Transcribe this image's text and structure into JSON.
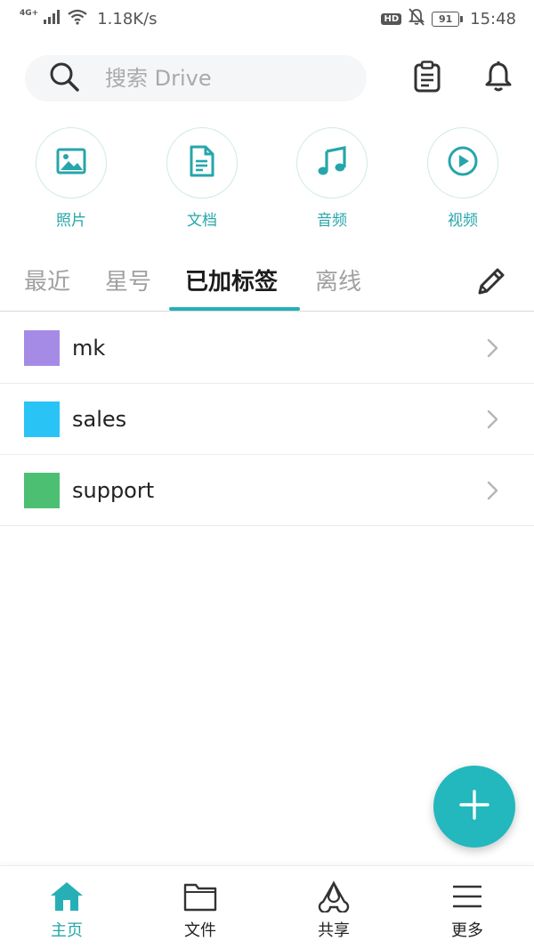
{
  "status_bar": {
    "network_type": "4G+",
    "speed": "1.18K/s",
    "hd": "HD",
    "battery": "91",
    "time": "15:48"
  },
  "search": {
    "placeholder": "搜索 Drive"
  },
  "categories": [
    {
      "label": "照片",
      "icon": "image-icon"
    },
    {
      "label": "文档",
      "icon": "document-icon"
    },
    {
      "label": "音频",
      "icon": "music-note-icon"
    },
    {
      "label": "视频",
      "icon": "play-circle-icon"
    }
  ],
  "tabs": [
    {
      "label": "最近",
      "active": false
    },
    {
      "label": "星号",
      "active": false
    },
    {
      "label": "已加标签",
      "active": true
    },
    {
      "label": "离线",
      "active": false
    }
  ],
  "labels": [
    {
      "name": "mk",
      "color": "#a68be6"
    },
    {
      "name": "sales",
      "color": "#29c4f5"
    },
    {
      "name": "support",
      "color": "#4dbf73"
    }
  ],
  "bottom_nav": [
    {
      "label": "主页",
      "icon": "home-icon",
      "active": true
    },
    {
      "label": "文件",
      "icon": "folder-icon",
      "active": false
    },
    {
      "label": "共享",
      "icon": "share-icon",
      "active": false
    },
    {
      "label": "更多",
      "icon": "menu-icon",
      "active": false
    }
  ],
  "colors": {
    "accent": "#26b0b6",
    "fab": "#22b8bd"
  }
}
